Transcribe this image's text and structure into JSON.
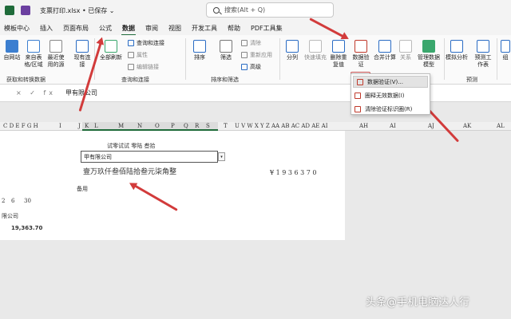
{
  "titlebar": {
    "filename": "支票打印.xlsx • 已保存 ⌄",
    "search_placeholder": "搜索(Alt + Q)"
  },
  "menu": [
    "模板中心",
    "插入",
    "页面布局",
    "公式",
    "数据",
    "审阅",
    "视图",
    "开发工具",
    "帮助",
    "PDF工具集"
  ],
  "ribbon": {
    "get_data": {
      "label": "获取和转换数据",
      "buttons": [
        "自网站",
        "来自表格/区域",
        "最近使用的源",
        "现有连接"
      ]
    },
    "queries": {
      "label": "查询和连接",
      "refresh": "全部刷新",
      "items": [
        "查询和连接",
        "属性",
        "编辑链接"
      ]
    },
    "sort_filter": {
      "label": "排序和筛选",
      "sort": "排序",
      "filter": "筛选",
      "items": [
        "清除",
        "重新应用",
        "高级"
      ]
    },
    "data_tools": {
      "buttons": [
        "分列",
        "快速填充",
        "删除重复值",
        "数据验证",
        "合并计算",
        "关系",
        "管理数据模型"
      ]
    },
    "forecast": {
      "label": "预测",
      "buttons": [
        "模拟分析",
        "预测工作表"
      ]
    },
    "cut": "组"
  },
  "dropdown": {
    "items": [
      "数据验证(V)...",
      "圈释无效数据(I)",
      "清除验证标识圈(R)"
    ]
  },
  "formula": {
    "fx": "× ✓ fx",
    "value": "甲有限公司"
  },
  "columns": {
    "left": "C D E F G H",
    "i": "I",
    "j": "J",
    "k": "K",
    "l": "L",
    "m": "M",
    "n": "N",
    "o": "O",
    "p": "P",
    "q": "Q",
    "r": "R",
    "s": "S",
    "t": "T",
    "mid": "U V W X Y Z AA AB AC AD AE AI",
    "ah": "AH",
    "ai": "AI",
    "aj": "AJ",
    "ak": "AK",
    "al": "AL"
  },
  "sheet": {
    "headers": "试零试试    零陆        叁拾",
    "cell_value": "甲有限公司",
    "amount_words": "壹万玖仟叁佰陆拾叁元柒角整",
    "amount_digits": "¥ 1 9 3 6 3 7 0",
    "memo": "备用",
    "left_col": [
      "2",
      "6",
      "30"
    ],
    "left_company": "限公司",
    "left_amount": "19,363.70"
  },
  "watermark": "头条@手机电脑达人行"
}
